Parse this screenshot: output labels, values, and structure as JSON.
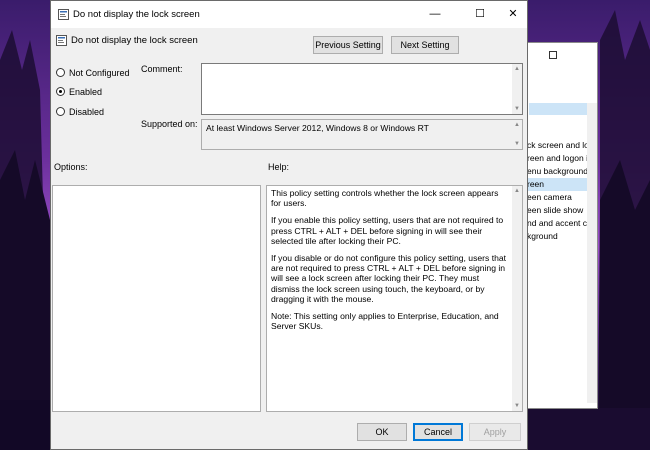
{
  "window": {
    "title": "Do not display the lock screen",
    "controls": {
      "minimize": "—",
      "maximize": "☐",
      "close": "✕"
    }
  },
  "header": {
    "title": "Do not display the lock screen",
    "prev_label": "Previous Setting",
    "next_label": "Next Setting"
  },
  "state_options": [
    {
      "label": "Not Configured",
      "checked": false
    },
    {
      "label": "Enabled",
      "checked": true
    },
    {
      "label": "Disabled",
      "checked": false
    }
  ],
  "comment_label": "Comment:",
  "supported": {
    "label": "Supported on:",
    "value": "At least Windows Server 2012, Windows 8 or Windows RT"
  },
  "options_label": "Options:",
  "help": {
    "label": "Help:",
    "paragraphs": [
      "This policy setting controls whether the lock screen appears for users.",
      "If you enable this policy setting, users that are not required to press CTRL + ALT + DEL before signing in will see their selected tile after locking their PC.",
      "If you disable or do not configure this policy setting, users that are not required to press CTRL + ALT + DEL before signing in will see a lock screen after locking their PC. They must dismiss the lock screen using touch, the keyboard, or by dragging it with the mouse.",
      "Note: This setting only applies to Enterprise, Education, and Server SKUs."
    ]
  },
  "footer": {
    "ok_label": "OK",
    "cancel_label": "Cancel",
    "apply_label": "Apply"
  },
  "background_window": {
    "items": [
      "ck screen and logo",
      "reen and logon im",
      "enu background",
      "reen",
      "een camera",
      "een slide show",
      "nd and accent col",
      "kground"
    ],
    "selected_index": 3
  }
}
